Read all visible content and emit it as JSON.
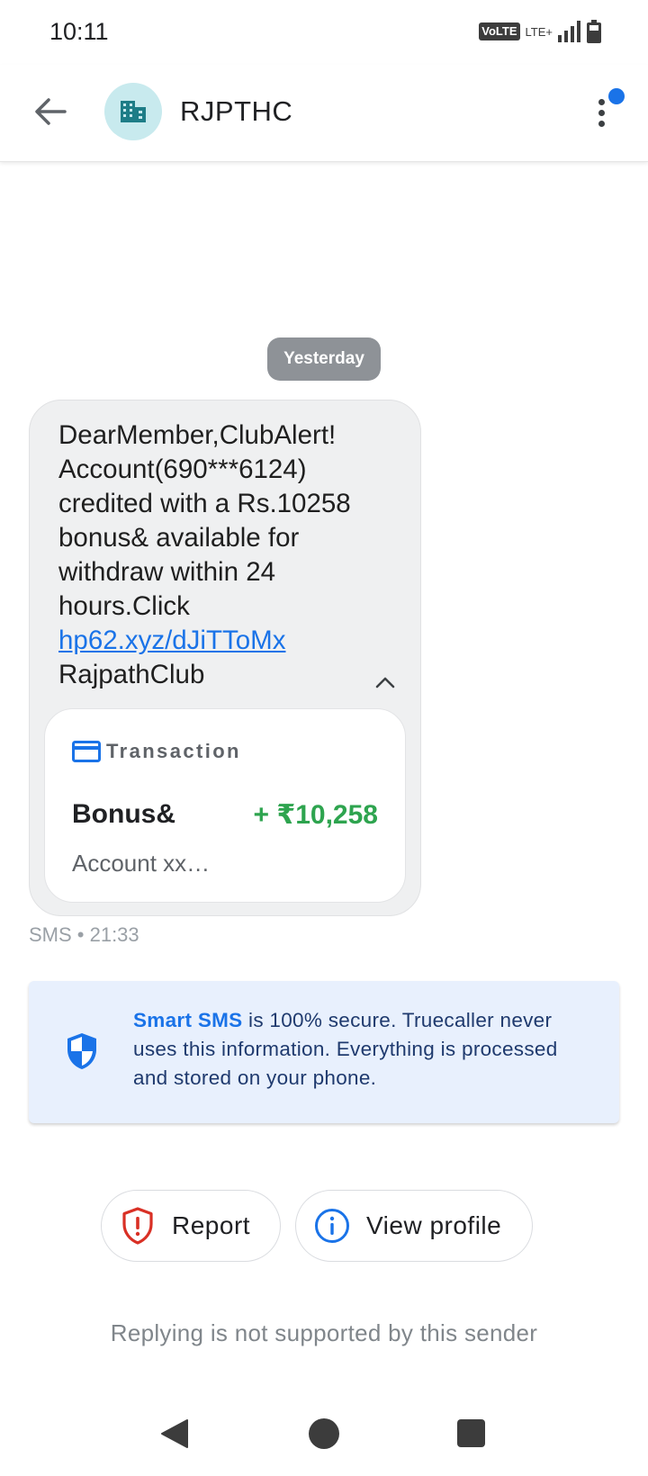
{
  "status_bar": {
    "time": "10:11",
    "volte": "VoLTE",
    "network": "LTE+",
    "icons": [
      "signal-icon",
      "battery-icon"
    ]
  },
  "app_bar": {
    "back_icon": "arrow-back-icon",
    "avatar_icon": "building-icon",
    "sender": "RJPTHC",
    "menu_icon": "more-vert-icon",
    "notification_dot_color": "#1a73e8"
  },
  "conversation": {
    "date_chip": "Yesterday",
    "message": {
      "text_before_link": "DearMember,ClubAlert! Account(690***6124) credited with a Rs.10258 bonus& available for withdraw within 24 hours.Click ",
      "link": "hp62.xyz/dJiTToMx",
      "text_after_link": "RajpathClub",
      "collapse_icon": "chevron-up-icon"
    },
    "transaction_card": {
      "icon": "credit-card-icon",
      "header": "Transaction",
      "title": "Bonus&",
      "amount": "+ ₹10,258",
      "amount_color": "#2ea44f",
      "subtitle": "Account xx…"
    },
    "meta": "SMS • 21:33"
  },
  "smart_sms": {
    "icon": "shield-icon",
    "strong": "Smart SMS",
    "text": " is 100% secure. Truecaller never uses this information. Everything is processed and stored on your phone."
  },
  "actions": {
    "report_label": "Report",
    "report_icon": "report-shield-icon",
    "profile_label": "View profile",
    "profile_icon": "info-icon"
  },
  "reply_note": "Replying is not supported by this sender",
  "nav": {
    "back_icon": "nav-back-icon",
    "home_icon": "nav-home-icon",
    "recents_icon": "nav-recents-icon"
  }
}
